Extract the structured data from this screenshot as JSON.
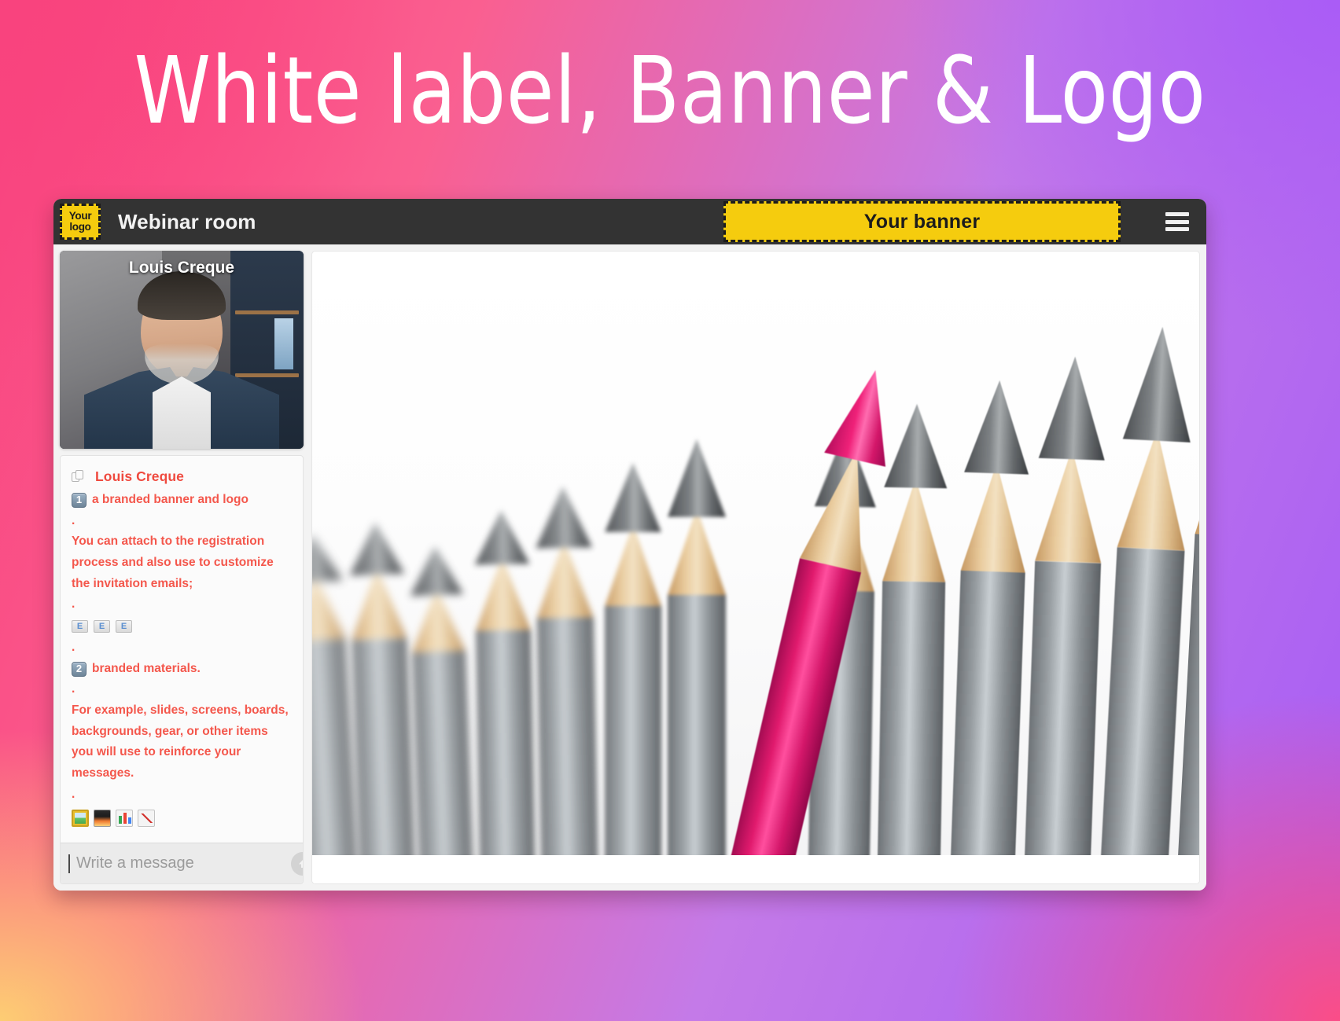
{
  "headline": "White label, Banner & Logo",
  "colors": {
    "gradient_top_left": "#f9437e",
    "gradient_top_right": "#a65cf5",
    "gradient_bottom_left": "#fdcd73",
    "gradient_bottom_right": "#fb4d87",
    "topbar": "#333333",
    "accent_yellow": "#f5cc0e",
    "chat_text_red": "#f4574c"
  },
  "topbar": {
    "logo_line1": "Your",
    "logo_line2": "logo",
    "room_title": "Webinar room",
    "banner_text": "Your banner",
    "menu_icon": "hamburger-menu-icon"
  },
  "video_tile": {
    "participant_name": "Louis Creque"
  },
  "chat": {
    "message": {
      "copy_icon": "copy-icon",
      "author": "Louis Creque",
      "blocks": [
        {
          "type": "keycap",
          "keycap": "1",
          "text": "a branded banner and logo"
        },
        {
          "type": "dot",
          "text": "."
        },
        {
          "type": "paragraph",
          "text": "You can attach to the registration process and also use to customize the invitation emails;"
        },
        {
          "type": "dot",
          "text": "."
        },
        {
          "type": "emoji-row",
          "emojis": [
            "envelope-icon",
            "envelope-icon",
            "envelope-icon"
          ]
        },
        {
          "type": "dot",
          "text": "."
        },
        {
          "type": "keycap",
          "keycap": "2",
          "text": "branded materials."
        },
        {
          "type": "dot",
          "text": "."
        },
        {
          "type": "paragraph",
          "text": "For example, slides, screens, boards, backgrounds, gear, or other items you will use to reinforce your messages."
        },
        {
          "type": "dot",
          "text": "."
        },
        {
          "type": "emoji-row",
          "emojis": [
            "framed-picture-icon",
            "photo-icon",
            "bar-chart-icon",
            "chart-increasing-icon"
          ]
        }
      ]
    },
    "composer": {
      "placeholder": "Write a message",
      "value": "",
      "send_icon": "send-arrow-up-icon"
    }
  },
  "stage": {
    "slide_description": "pencils-photo-one-pink-among-grey"
  }
}
